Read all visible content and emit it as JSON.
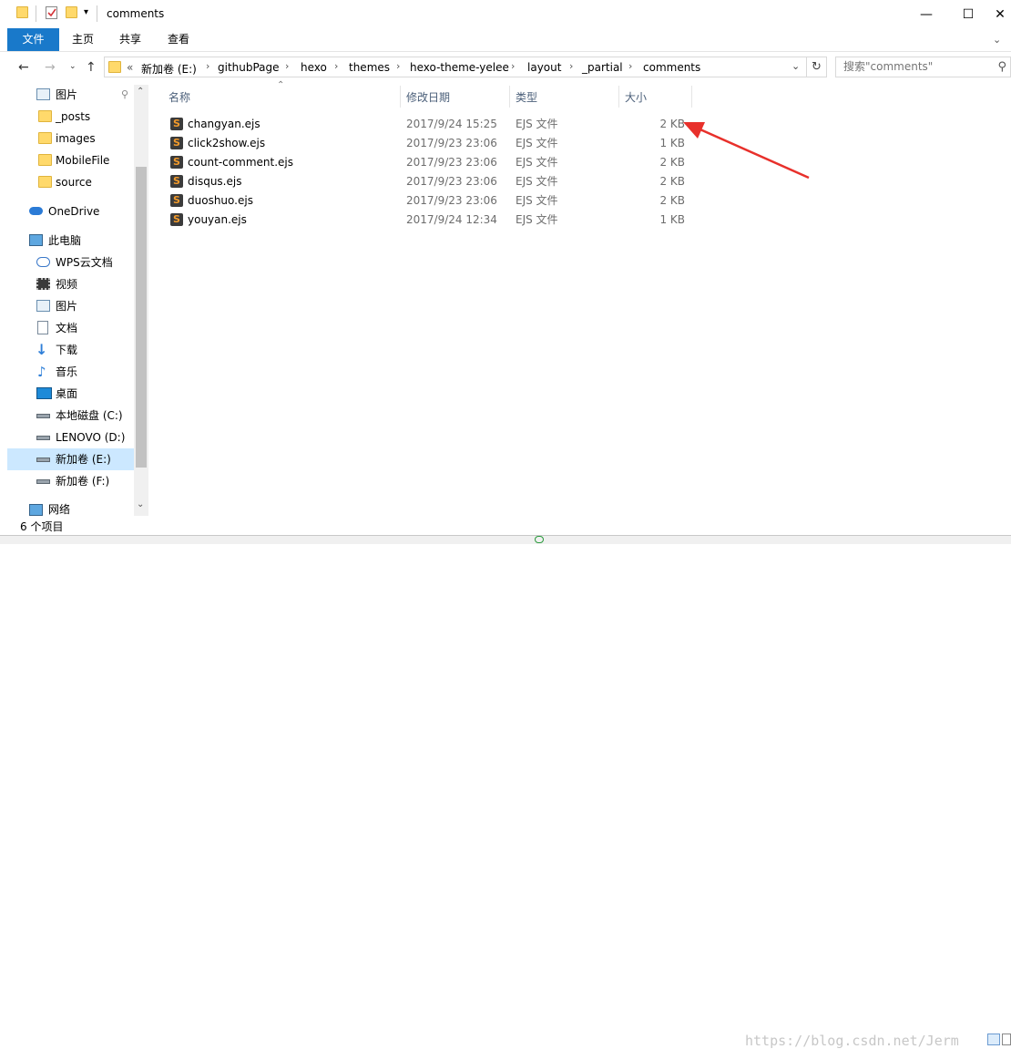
{
  "window": {
    "title": "comments"
  },
  "ribbon": {
    "tabs": [
      "文件",
      "主页",
      "共享",
      "查看"
    ]
  },
  "address": {
    "lead": "«",
    "crumbs": [
      "新加卷 (E:)",
      "githubPage",
      "hexo",
      "themes",
      "hexo-theme-yelee",
      "layout",
      "_partial",
      "comments"
    ]
  },
  "search": {
    "placeholder": "搜索\"comments\""
  },
  "nav": {
    "quick": [
      "图片",
      "_posts",
      "images",
      "MobileFile",
      "source"
    ],
    "onedrive": "OneDrive",
    "thispc": "此电脑",
    "pcitems": [
      "WPS云文档",
      "视频",
      "图片",
      "文档",
      "下载",
      "音乐",
      "桌面",
      "本地磁盘 (C:)",
      "LENOVO (D:)",
      "新加卷 (E:)",
      "新加卷 (F:)"
    ],
    "network": "网络"
  },
  "columns": {
    "name": "名称",
    "date": "修改日期",
    "type": "类型",
    "size": "大小"
  },
  "files": [
    {
      "name": "changyan.ejs",
      "date": "2017/9/24 15:25",
      "type": "EJS 文件",
      "size": "2 KB"
    },
    {
      "name": "click2show.ejs",
      "date": "2017/9/23 23:06",
      "type": "EJS 文件",
      "size": "1 KB"
    },
    {
      "name": "count-comment.ejs",
      "date": "2017/9/23 23:06",
      "type": "EJS 文件",
      "size": "2 KB"
    },
    {
      "name": "disqus.ejs",
      "date": "2017/9/23 23:06",
      "type": "EJS 文件",
      "size": "2 KB"
    },
    {
      "name": "duoshuo.ejs",
      "date": "2017/9/23 23:06",
      "type": "EJS 文件",
      "size": "2 KB"
    },
    {
      "name": "youyan.ejs",
      "date": "2017/9/24 12:34",
      "type": "EJS 文件",
      "size": "1 KB"
    }
  ],
  "status": {
    "count": "6 个项目"
  },
  "watermark": "https://blog.csdn.net/Jerm",
  "colors": {
    "accent": "#1979ca",
    "selection": "#cce8ff",
    "annotation": "#e8302b"
  }
}
